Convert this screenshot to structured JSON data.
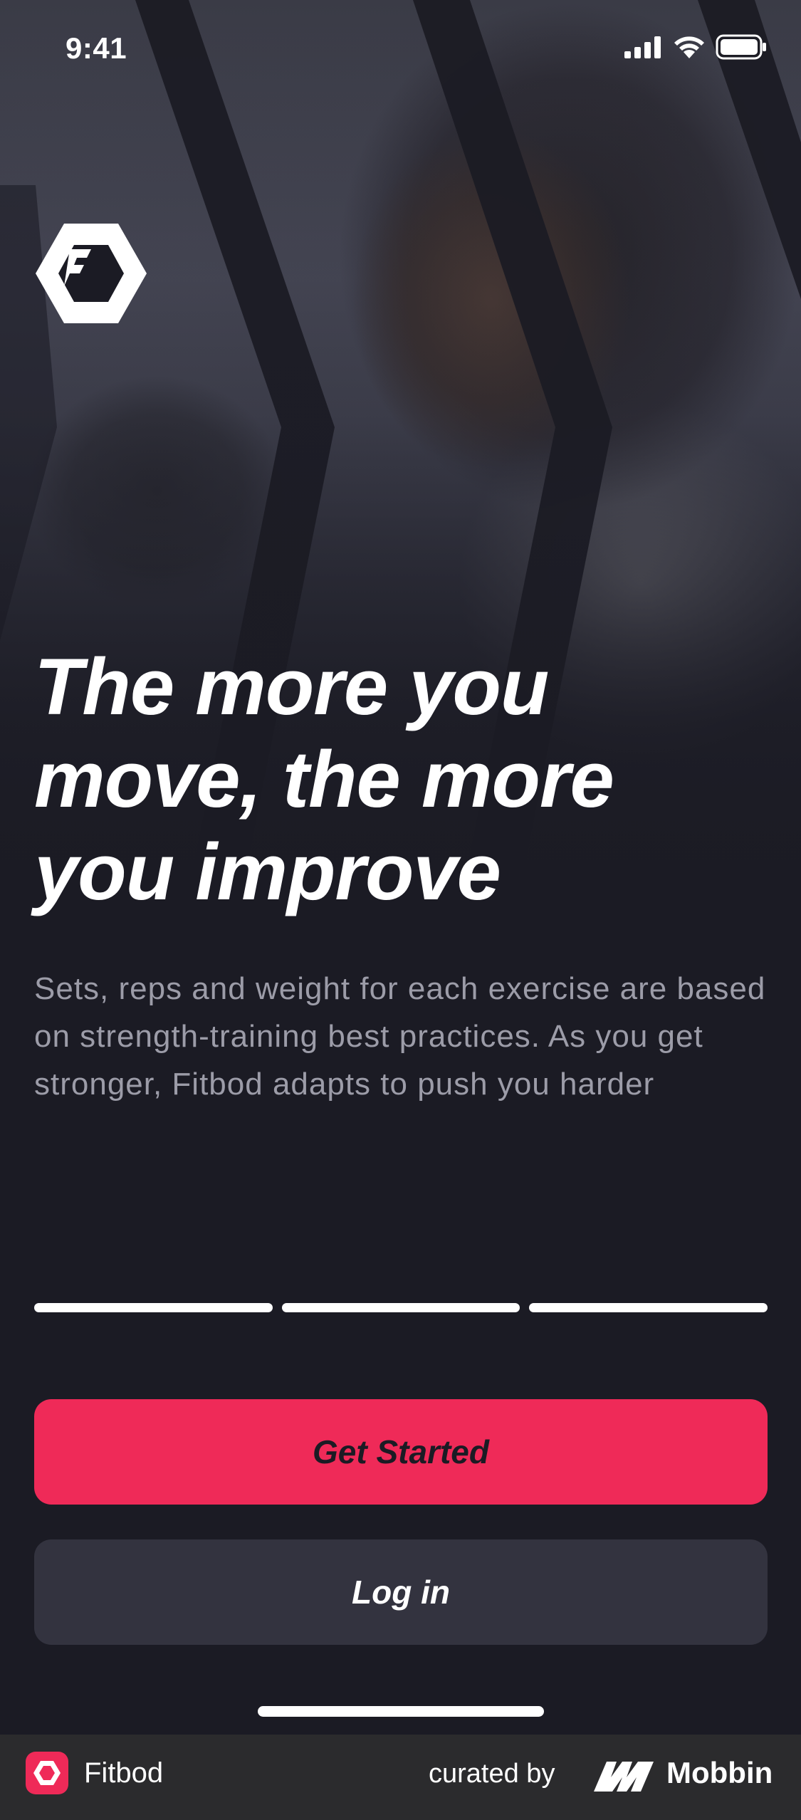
{
  "status_bar": {
    "time": "9:41",
    "icons": [
      "cellular-signal-icon",
      "wifi-icon",
      "battery-icon"
    ]
  },
  "app": {
    "logo_icon": "fitbod-hexagon-logo"
  },
  "onboarding": {
    "headline": "The more you move, the more you improve",
    "description": "Sets, reps and weight for each exercise are based on strength-training best practices. As you get stronger, Fitbod adapts to push you harder",
    "progress": {
      "total_steps": 3,
      "filled_steps": 3
    }
  },
  "actions": {
    "primary_label": "Get Started",
    "secondary_label": "Log in"
  },
  "footer": {
    "app_name": "Fitbod",
    "curated_label": "curated by",
    "brand_name": "Mobbin"
  },
  "colors": {
    "background": "#1b1b24",
    "accent": "#ef2a58",
    "secondary_button": "#33333f",
    "body_text": "#9c9ca8",
    "footer_bg": "#2b2b2d"
  }
}
